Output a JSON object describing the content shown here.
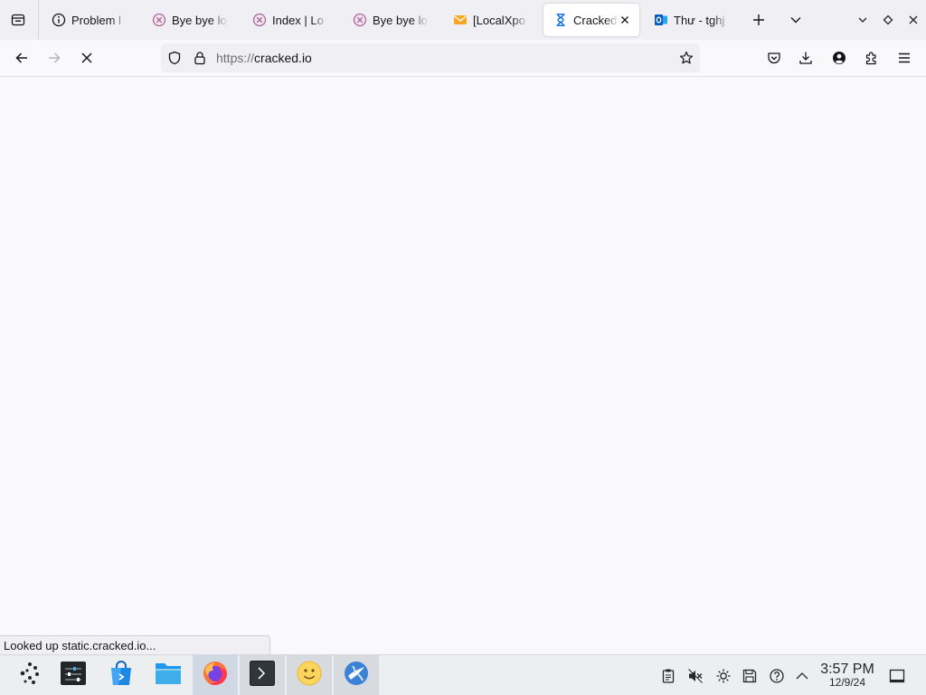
{
  "tabs": [
    {
      "label": "Problem l",
      "icon": "info-circle-icon"
    },
    {
      "label": "Bye bye lo",
      "icon": "x-circle-icon"
    },
    {
      "label": "Index | Lo",
      "icon": "x-circle-icon"
    },
    {
      "label": "Bye bye lo",
      "icon": "x-circle-icon"
    },
    {
      "label": "[LocalXpo",
      "icon": "envelope-icon"
    },
    {
      "label": "Cracked",
      "icon": "hourglass-icon",
      "active": true
    },
    {
      "label": "Thư - tghj",
      "icon": "outlook-icon"
    }
  ],
  "toolbar": {
    "left_icons": [
      "back-arrow-icon",
      "forward-arrow-icon",
      "stop-loading-icon"
    ],
    "right_icons": [
      "pocket-icon",
      "download-icon",
      "account-icon",
      "extensions-icon",
      "menu-icon"
    ]
  },
  "urlbar": {
    "scheme": "https://",
    "host": "cracked.io",
    "icons": [
      "tracking-shield-icon",
      "lock-icon",
      "bookmark-star-icon"
    ]
  },
  "status": {
    "text": "Looked up static.cracked.io..."
  },
  "taskbar": {
    "apps": [
      {
        "icon": "application-launcher-icon"
      },
      {
        "icon": "system-settings-icon"
      },
      {
        "icon": "discover-store-icon"
      },
      {
        "icon": "file-manager-icon"
      },
      {
        "icon": "firefox-icon",
        "open": true,
        "current": true
      },
      {
        "icon": "terminal-icon",
        "open": true
      },
      {
        "icon": "emoji-icon",
        "open": true
      },
      {
        "icon": "globe-browser-icon",
        "open": true
      }
    ],
    "tray": [
      "clipboard-icon",
      "volume-muted-icon",
      "brightness-icon",
      "disk-icon",
      "help-icon",
      "tray-expand-icon"
    ],
    "clock": {
      "time": "3:57 PM",
      "date": "12/9/24"
    }
  },
  "colors": {
    "tab_bar": "#f0f0f4",
    "page_background": "#f9f9fb",
    "active_tab": "#ffffff",
    "accent": "#0060df",
    "taskbar": "#eceef0"
  }
}
